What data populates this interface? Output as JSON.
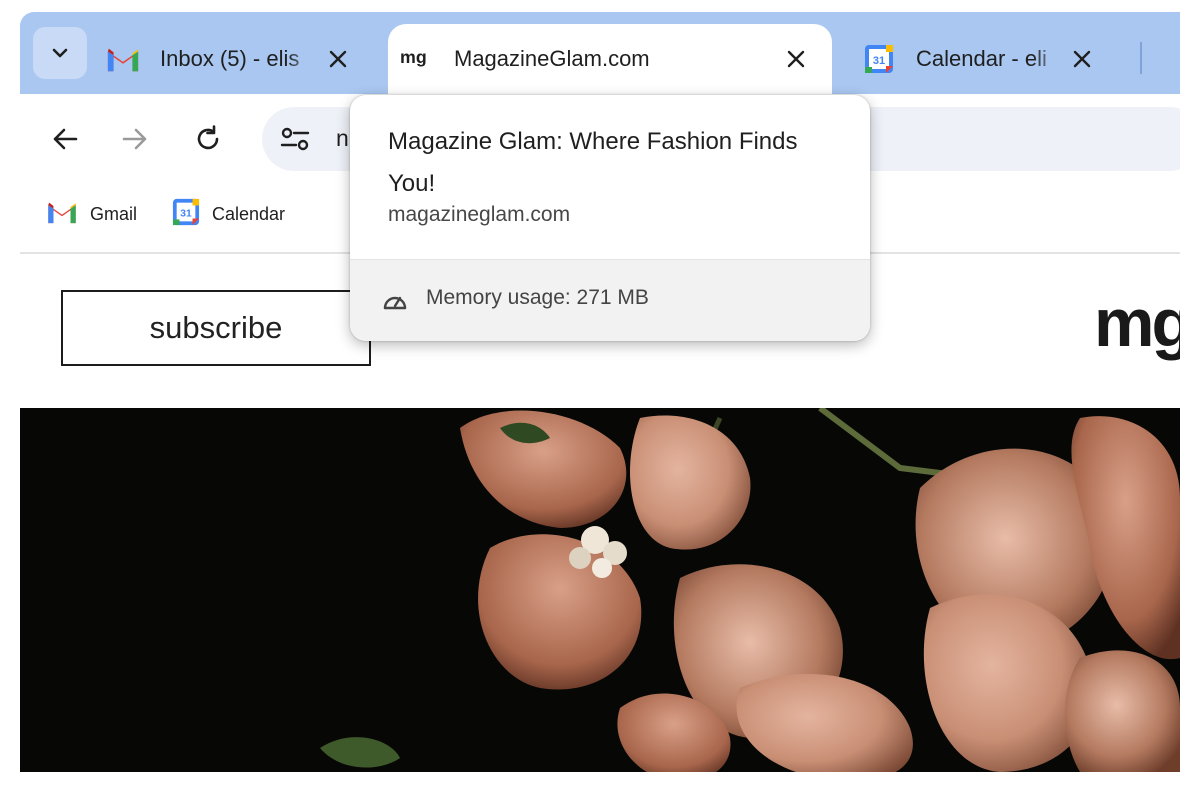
{
  "browser": {
    "tabs": [
      {
        "title": "Inbox (5) - elis",
        "favicon": "gmail-icon",
        "active": false
      },
      {
        "title": "MagazineGlam.com",
        "favicon": "mg-logo-icon",
        "active": true
      },
      {
        "title": "Calendar - eli",
        "favicon": "calendar-icon",
        "active": false
      }
    ],
    "omnibox": {
      "url_visible": "n"
    },
    "bookmarks": [
      {
        "label": "Gmail",
        "icon": "gmail-icon"
      },
      {
        "label": "Calendar",
        "icon": "calendar-icon"
      }
    ],
    "calendar_icon_day": "31",
    "mg_favicon_text": "mg"
  },
  "hover_card": {
    "title": "Magazine Glam: Where Fashion Finds You!",
    "domain": "magazineglam.com",
    "memory": "Memory usage: 271 MB"
  },
  "page": {
    "subscribe_label": "subscribe",
    "logo_text": "mg"
  },
  "colors": {
    "tabstrip": "#a9c7f0",
    "omnibox": "#eef2f8",
    "gmail_red": "#ea4335",
    "gmail_blue": "#4285f4",
    "gmail_green": "#34a853",
    "gmail_yellow": "#fbbc04"
  }
}
